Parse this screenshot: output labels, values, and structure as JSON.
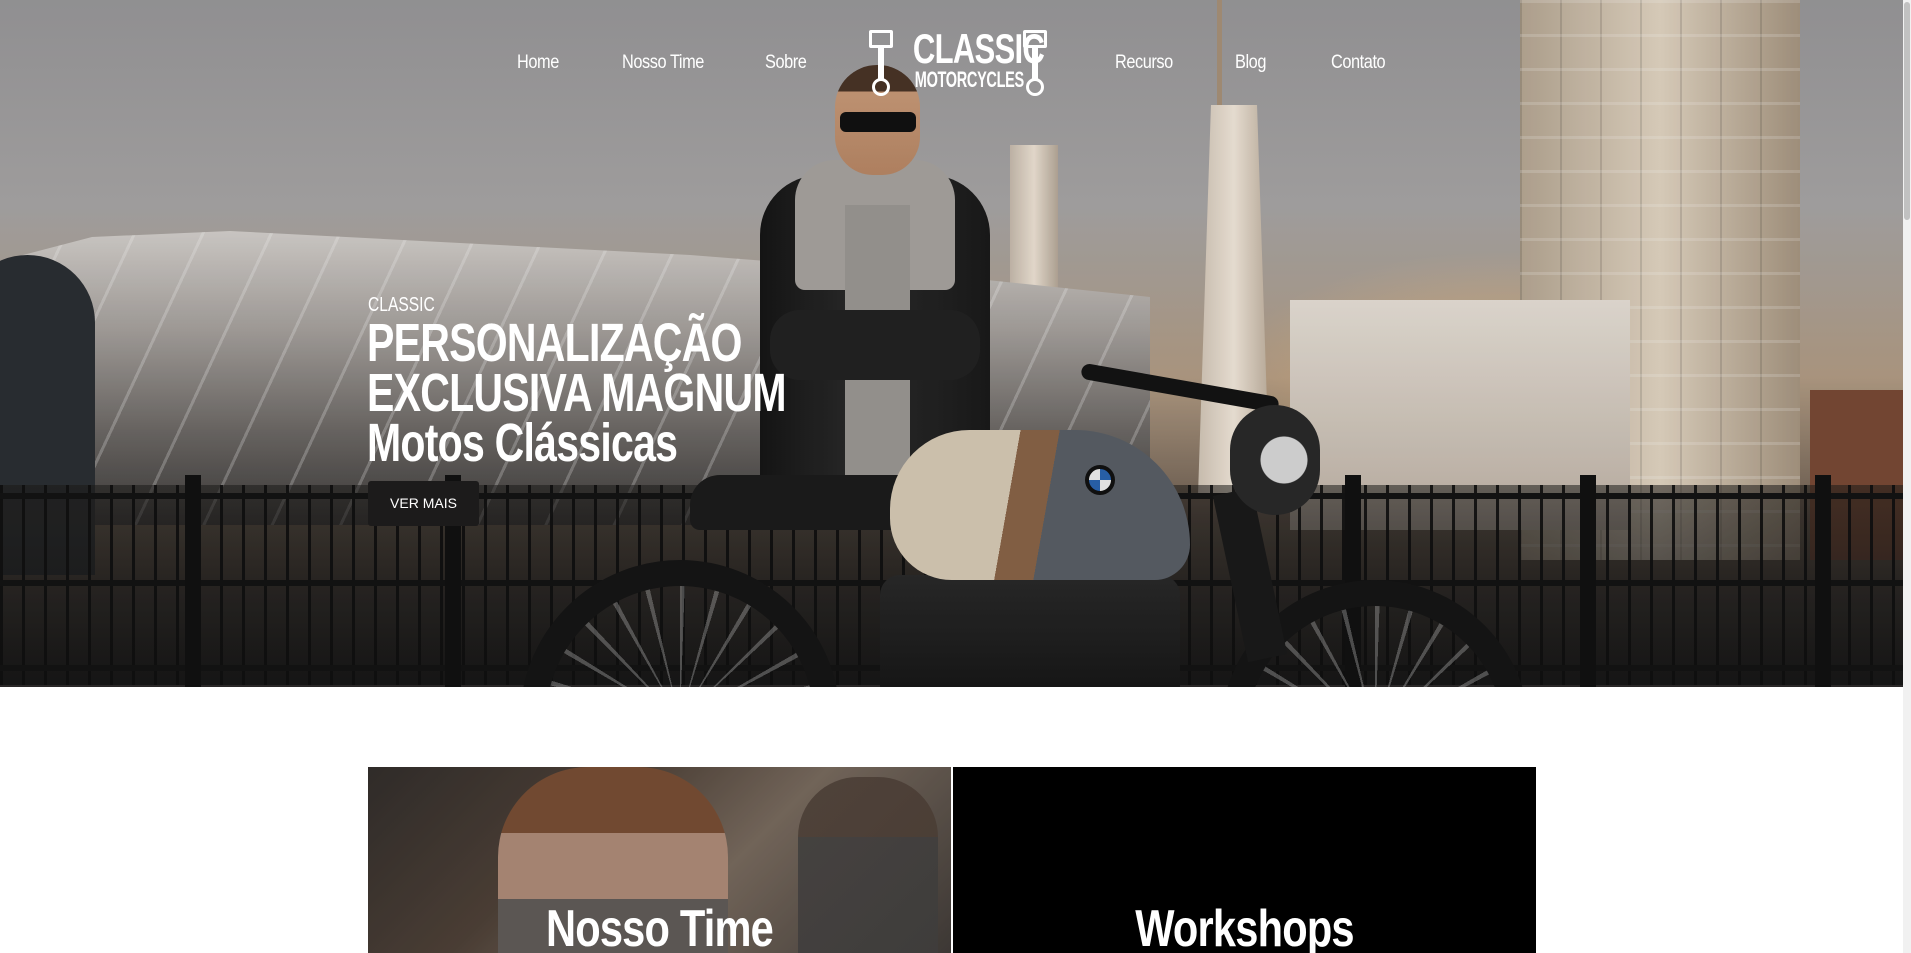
{
  "nav": {
    "left": [
      "Home",
      "Nosso Time",
      "Sobre"
    ],
    "right": [
      "Recurso",
      "Blog",
      "Contato"
    ]
  },
  "logo": {
    "line1": "CLASSIC",
    "line2": "MOTORCYCLES"
  },
  "hero": {
    "eyebrow": "CLASSIC",
    "headline": [
      "PERSONALIZAÇÃO",
      "EXCLUSIVA MAGNUM",
      "Motos Clássicas"
    ],
    "cta": "VER MAIS"
  },
  "cards": [
    {
      "title": "Nosso Time"
    },
    {
      "title": "Workshops"
    }
  ],
  "colors": {
    "button_bg": "#1c1b1b",
    "card_dark": "#000000",
    "text_light": "#ffffff"
  },
  "icons": [
    "piston-icon",
    "piston-icon"
  ]
}
